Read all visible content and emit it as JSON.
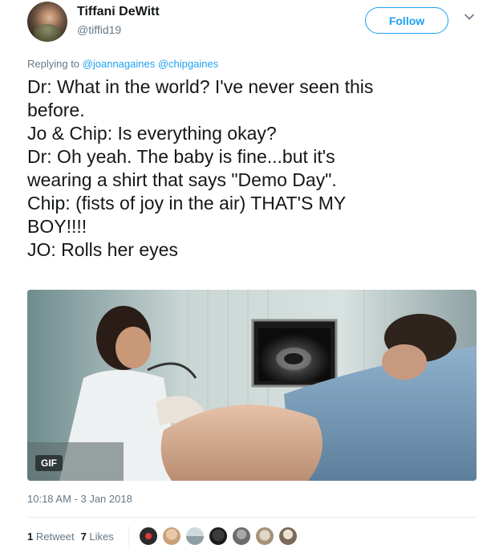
{
  "author": {
    "display_name": "Tiffani DeWitt",
    "handle": "@tiffid19"
  },
  "follow_label": "Follow",
  "reply": {
    "prefix": "Replying to",
    "mentions": [
      "@joannagaines",
      "@chipgaines"
    ]
  },
  "tweet_lines": [
    "Dr: What in the world? I've never seen this",
    "before.",
    "Jo & Chip: Is everything okay?",
    "Dr: Oh yeah. The baby is fine...but it's",
    "wearing a shirt that says \"Demo Day\".",
    "Chip: (fists of joy in the air) THAT'S MY",
    "BOY!!!!",
    "JO: Rolls her eyes"
  ],
  "media": {
    "badge": "GIF"
  },
  "timestamp": "10:18 AM - 3 Jan 2018",
  "stats": {
    "retweet_count": "1",
    "retweet_label": "Retweet",
    "like_count": "7",
    "like_label": "Likes"
  },
  "colors": {
    "accent": "#1da1f2",
    "secondary_text": "#657786",
    "primary_text": "#14171a"
  }
}
